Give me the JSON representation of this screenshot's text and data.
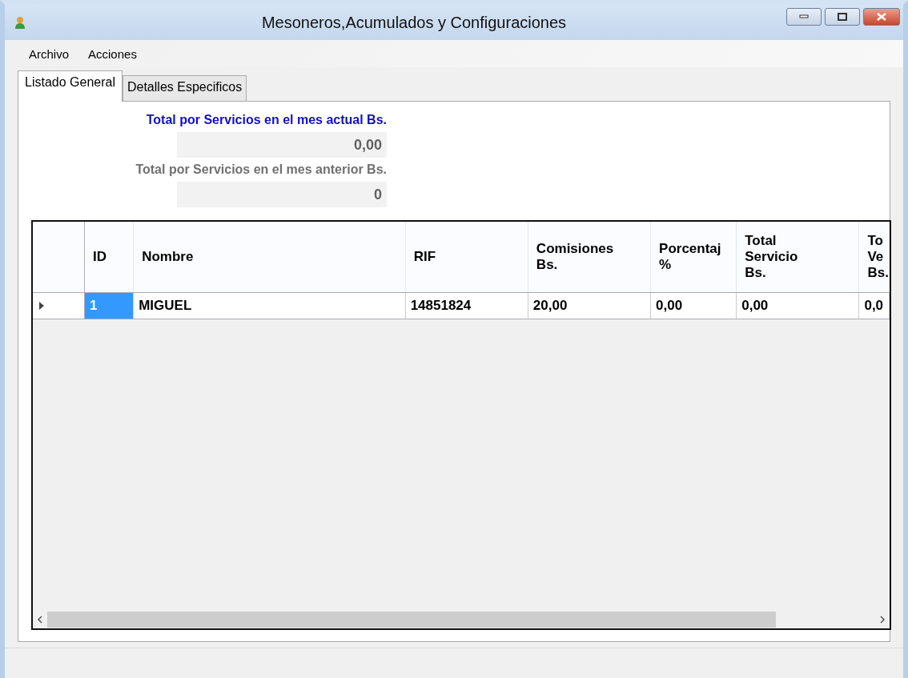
{
  "window": {
    "title": "Mesoneros,Acumulados y Configuraciones"
  },
  "menu": [
    "Archivo",
    "Acciones"
  ],
  "tabs": [
    {
      "label": "Listado General",
      "selected": true
    },
    {
      "label": "Detalles Especificos",
      "selected": false
    }
  ],
  "totals": [
    {
      "label": "Total por Servicios en el mes actual Bs.",
      "value": "0,00",
      "disabled": false
    },
    {
      "label": "Total por Servicios en el mes anterior Bs.",
      "value": "0",
      "disabled": true
    }
  ],
  "table": {
    "columns": [
      "ID",
      "Nombre",
      "RIF",
      "Comisiones\nBs.",
      "Porcentaj\n%",
      "Total\nServicio\nBs.",
      "To\nVe\nBs."
    ],
    "rows": [
      {
        "selected": true,
        "cells": [
          {
            "text": "1",
            "selected": true
          },
          {
            "text": "MIGUEL",
            "selected": false
          },
          {
            "text": "14851824",
            "selected": false
          },
          {
            "text": "20,00",
            "selected": false
          },
          {
            "text": "0,00",
            "selected": false
          },
          {
            "text": "0,00",
            "selected": false
          },
          {
            "text": "0,0",
            "selected": false
          }
        ]
      }
    ]
  }
}
